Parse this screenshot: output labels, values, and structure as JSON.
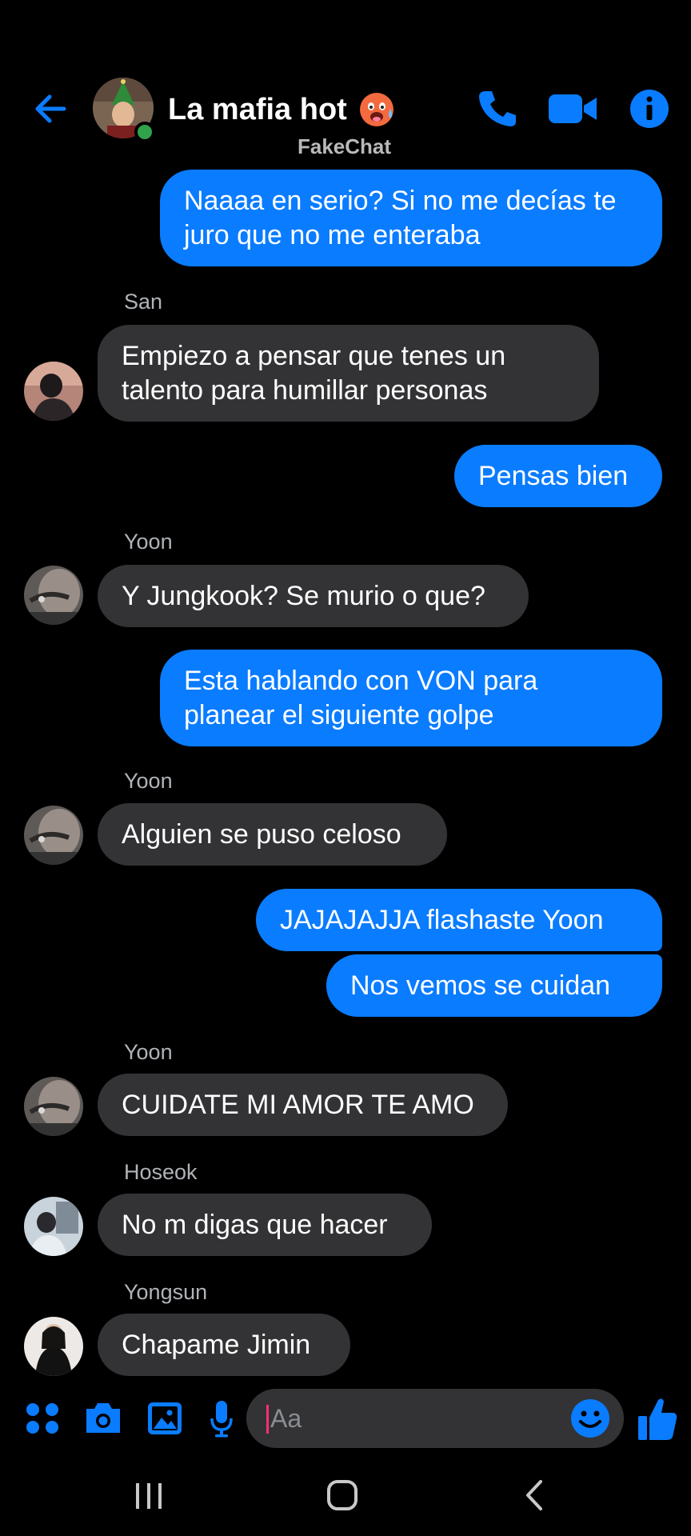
{
  "header": {
    "title": "La mafia hot",
    "watermark": "FakeChat",
    "back_icon": "arrow-left-icon",
    "call_icon": "phone-icon",
    "video_icon": "video-camera-icon",
    "info_icon": "info-icon"
  },
  "messages": [
    {
      "dir": "out",
      "line1": "Naaaa en serio? Si no me decías te",
      "line2": "juro que no me enteraba"
    },
    {
      "dir": "in",
      "sender": "San",
      "line1": "Empiezo a pensar que tenes un",
      "line2": "talento para humillar personas"
    },
    {
      "dir": "out",
      "text": "Pensas bien"
    },
    {
      "dir": "in",
      "sender": "Yoon",
      "text": "Y Jungkook? Se murio o que?"
    },
    {
      "dir": "out",
      "line1": "Esta hablando con VON para",
      "line2": "planear el siguiente golpe"
    },
    {
      "dir": "in",
      "sender": "Yoon",
      "text": "Alguien se puso celoso"
    },
    {
      "dir": "out",
      "text": "JAJAJAJJA flashaste Yoon"
    },
    {
      "dir": "out",
      "text": "Nos vemos se cuidan"
    },
    {
      "dir": "in",
      "sender": "Yoon",
      "text": "CUIDATE MI AMOR TE AMO"
    },
    {
      "dir": "in",
      "sender": "Hoseok",
      "text": "No m digas que hacer"
    },
    {
      "dir": "in",
      "sender": "Yongsun",
      "text": "Chapame Jimin"
    }
  ],
  "composer": {
    "placeholder": "Aa",
    "value": "",
    "icons": [
      "apps-grid-icon",
      "camera-icon",
      "image-icon",
      "microphone-icon",
      "emoji-smile-icon",
      "thumbs-up-icon"
    ]
  },
  "navbar": {
    "icons": [
      "recent-apps-icon",
      "home-icon",
      "back-chevron-icon"
    ]
  },
  "colors": {
    "accent": "#0a7cff",
    "incoming_bubble": "#333335",
    "background": "#000000",
    "online": "#31a24c"
  }
}
